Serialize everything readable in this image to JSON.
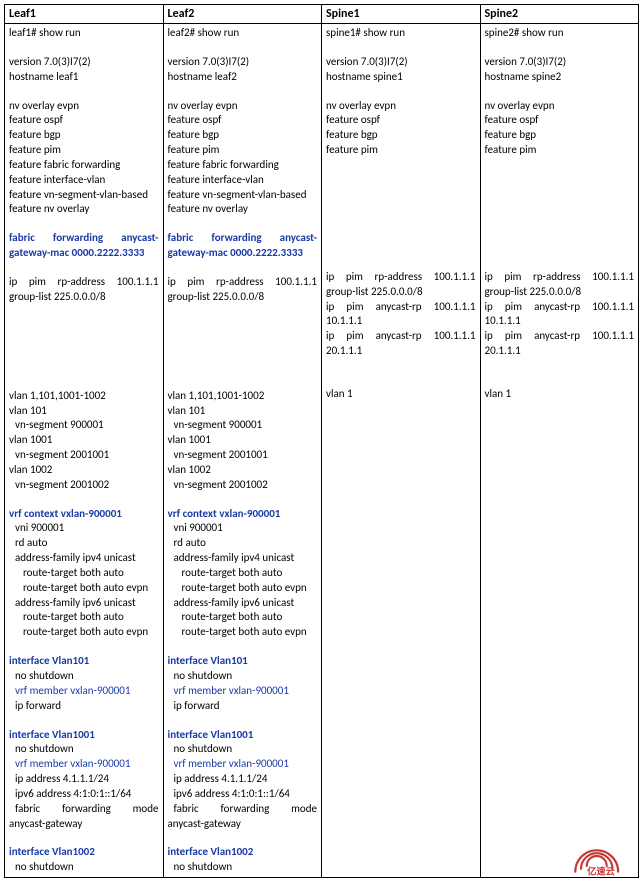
{
  "headers": [
    "Leaf1",
    "Leaf2",
    "Spine1",
    "Spine2"
  ],
  "cols": [
    [
      {
        "t": "leaf1# show run"
      },
      {
        "blank": true
      },
      {
        "t": "version 7.0(3)I7(2)"
      },
      {
        "t": "hostname leaf1"
      },
      {
        "blank": true
      },
      {
        "t": "nv overlay evpn"
      },
      {
        "t": "feature ospf"
      },
      {
        "t": "feature bgp"
      },
      {
        "t": "feature pim"
      },
      {
        "t": "feature fabric forwarding"
      },
      {
        "t": "feature interface-vlan"
      },
      {
        "t": "feature vn-segment-vlan-based"
      },
      {
        "t": "feature nv overlay"
      },
      {
        "blank": true
      },
      {
        "hl": true,
        "just": [
          "fabric",
          "forwarding",
          "anycast-"
        ]
      },
      {
        "hl": true,
        "t": "gateway-mac 0000.2222.3333"
      },
      {
        "blank": true
      },
      {
        "just": [
          "ip",
          "pim",
          "rp-address",
          "100.1.1.1"
        ]
      },
      {
        "t": "group-list 225.0.0.0/8"
      },
      {
        "blank": true
      },
      {
        "blank": true
      },
      {
        "blank": true
      },
      {
        "blank": true
      },
      {
        "blank": true
      },
      {
        "blank": true
      },
      {
        "t": "vlan 1,101,1001-1002"
      },
      {
        "t": "vlan 101"
      },
      {
        "t": "vn-segment 900001",
        "ind": 1
      },
      {
        "t": "vlan 1001"
      },
      {
        "t": "vn-segment 2001001",
        "ind": 1
      },
      {
        "t": "vlan 1002"
      },
      {
        "t": "vn-segment 2001002",
        "ind": 1
      },
      {
        "blank": true
      },
      {
        "hl": true,
        "t": "vrf context vxlan-900001"
      },
      {
        "t": "vni 900001",
        "ind": 1
      },
      {
        "t": "rd auto",
        "ind": 1
      },
      {
        "t": "address-family ipv4 unicast",
        "ind": 1
      },
      {
        "t": "route-target both auto",
        "ind": 2
      },
      {
        "t": "route-target both auto evpn",
        "ind": 2
      },
      {
        "t": "address-family ipv6 unicast",
        "ind": 1
      },
      {
        "t": "route-target both auto",
        "ind": 2
      },
      {
        "t": "route-target both auto evpn",
        "ind": 2
      },
      {
        "blank": true
      },
      {
        "hl": true,
        "t": "interface Vlan101"
      },
      {
        "t": "no shutdown",
        "ind": 1
      },
      {
        "hl2": true,
        "t": "vrf member vxlan-900001",
        "ind": 1
      },
      {
        "t": "ip forward",
        "ind": 1
      },
      {
        "blank": true
      },
      {
        "hl": true,
        "t": "interface Vlan1001"
      },
      {
        "t": "no shutdown",
        "ind": 1
      },
      {
        "hl2": true,
        "t": "vrf member vxlan-900001",
        "ind": 1
      },
      {
        "t": "ip address 4.1.1.1/24",
        "ind": 1
      },
      {
        "t": "ipv6 address 4:1:0:1::1/64",
        "ind": 1
      },
      {
        "just": [
          "fabric",
          "forwarding",
          "mode"
        ],
        "ind": 1
      },
      {
        "t": "anycast-gateway"
      },
      {
        "blank": true
      },
      {
        "hl": true,
        "t": "interface Vlan1002"
      },
      {
        "t": "no shutdown",
        "ind": 1
      }
    ],
    [
      {
        "t": "leaf2# show run"
      },
      {
        "blank": true
      },
      {
        "t": "version 7.0(3)I7(2)"
      },
      {
        "t": "hostname leaf2"
      },
      {
        "blank": true
      },
      {
        "t": "nv overlay evpn"
      },
      {
        "t": "feature ospf"
      },
      {
        "t": "feature bgp"
      },
      {
        "t": "feature pim"
      },
      {
        "t": "feature fabric forwarding"
      },
      {
        "t": "feature interface-vlan"
      },
      {
        "t": "feature vn-segment-vlan-based"
      },
      {
        "t": "feature nv overlay"
      },
      {
        "blank": true
      },
      {
        "hl": true,
        "just": [
          "fabric",
          "forwarding",
          "anycast-"
        ]
      },
      {
        "hl": true,
        "t": "gateway-mac 0000.2222.3333"
      },
      {
        "blank": true
      },
      {
        "just": [
          "ip",
          "pim",
          "rp-address",
          "100.1.1.1"
        ]
      },
      {
        "t": "group-list 225.0.0.0/8"
      },
      {
        "blank": true
      },
      {
        "blank": true
      },
      {
        "blank": true
      },
      {
        "blank": true
      },
      {
        "blank": true
      },
      {
        "blank": true
      },
      {
        "t": "vlan 1,101,1001-1002"
      },
      {
        "t": "vlan 101"
      },
      {
        "t": "vn-segment 900001",
        "ind": 1
      },
      {
        "t": "vlan 1001"
      },
      {
        "t": "vn-segment 2001001",
        "ind": 1
      },
      {
        "t": "vlan 1002"
      },
      {
        "t": "vn-segment 2001002",
        "ind": 1
      },
      {
        "blank": true
      },
      {
        "hl": true,
        "t": "vrf context vxlan-900001"
      },
      {
        "t": "vni 900001",
        "ind": 1
      },
      {
        "t": "rd auto",
        "ind": 1
      },
      {
        "t": "address-family ipv4 unicast",
        "ind": 1
      },
      {
        "t": "route-target both auto",
        "ind": 2
      },
      {
        "t": "route-target both auto evpn",
        "ind": 2
      },
      {
        "t": "address-family ipv6 unicast",
        "ind": 1
      },
      {
        "t": "route-target both auto",
        "ind": 2
      },
      {
        "t": "route-target both auto evpn",
        "ind": 2
      },
      {
        "blank": true
      },
      {
        "hl": true,
        "t": "interface Vlan101"
      },
      {
        "t": "no shutdown",
        "ind": 1
      },
      {
        "hl2": true,
        "t": "vrf member vxlan-900001",
        "ind": 1
      },
      {
        "t": "ip forward",
        "ind": 1
      },
      {
        "blank": true
      },
      {
        "hl": true,
        "t": "interface Vlan1001"
      },
      {
        "t": "no shutdown",
        "ind": 1
      },
      {
        "hl2": true,
        "t": "vrf member vxlan-900001",
        "ind": 1
      },
      {
        "t": "ip address 4.1.1.1/24",
        "ind": 1
      },
      {
        "t": "ipv6 address 4:1:0:1::1/64",
        "ind": 1
      },
      {
        "just": [
          "fabric",
          "forwarding",
          "mode"
        ],
        "ind": 1
      },
      {
        "t": "anycast-gateway"
      },
      {
        "blank": true
      },
      {
        "hl": true,
        "t": "interface Vlan1002"
      },
      {
        "t": "no shutdown",
        "ind": 1
      }
    ],
    [
      {
        "t": "spine1# show run"
      },
      {
        "blank": true
      },
      {
        "t": "version 7.0(3)I7(2)"
      },
      {
        "t": "hostname spine1"
      },
      {
        "blank": true
      },
      {
        "t": "nv overlay evpn"
      },
      {
        "t": "feature ospf"
      },
      {
        "t": "feature bgp"
      },
      {
        "t": "feature pim"
      },
      {
        "blank": true
      },
      {
        "blank": true
      },
      {
        "blank": true
      },
      {
        "blank": true
      },
      {
        "blank": true
      },
      {
        "blank": true
      },
      {
        "blank": true
      },
      {
        "blank": true
      },
      {
        "just": [
          "ip",
          "pim",
          "rp-address",
          "100.1.1.1"
        ]
      },
      {
        "t": "group-list 225.0.0.0/8"
      },
      {
        "just": [
          "ip",
          "pim",
          "anycast-rp",
          "100.1.1.1"
        ]
      },
      {
        "t": "10.1.1.1"
      },
      {
        "just": [
          "ip",
          "pim",
          "anycast-rp",
          "100.1.1.1"
        ]
      },
      {
        "t": "20.1.1.1"
      },
      {
        "blank": true
      },
      {
        "blank": true
      },
      {
        "t": "vlan 1"
      }
    ],
    [
      {
        "t": "spine2# show run"
      },
      {
        "blank": true
      },
      {
        "t": "version 7.0(3)I7(2)"
      },
      {
        "t": "hostname spine2"
      },
      {
        "blank": true
      },
      {
        "t": "nv overlay evpn"
      },
      {
        "t": "feature ospf"
      },
      {
        "t": "feature bgp"
      },
      {
        "t": "feature pim"
      },
      {
        "blank": true
      },
      {
        "blank": true
      },
      {
        "blank": true
      },
      {
        "blank": true
      },
      {
        "blank": true
      },
      {
        "blank": true
      },
      {
        "blank": true
      },
      {
        "blank": true
      },
      {
        "just": [
          "ip",
          "pim",
          "rp-address",
          "100.1.1.1"
        ]
      },
      {
        "t": "group-list 225.0.0.0/8"
      },
      {
        "just": [
          "ip",
          "pim",
          "anycast-rp",
          "100.1.1.1"
        ]
      },
      {
        "t": "10.1.1.1"
      },
      {
        "just": [
          "ip",
          "pim",
          "anycast-rp",
          "100.1.1.1"
        ]
      },
      {
        "t": "20.1.1.1"
      },
      {
        "blank": true
      },
      {
        "blank": true
      },
      {
        "t": "vlan 1"
      }
    ]
  ],
  "logo_text": "亿速云",
  "logo_color": "#c23a3a"
}
